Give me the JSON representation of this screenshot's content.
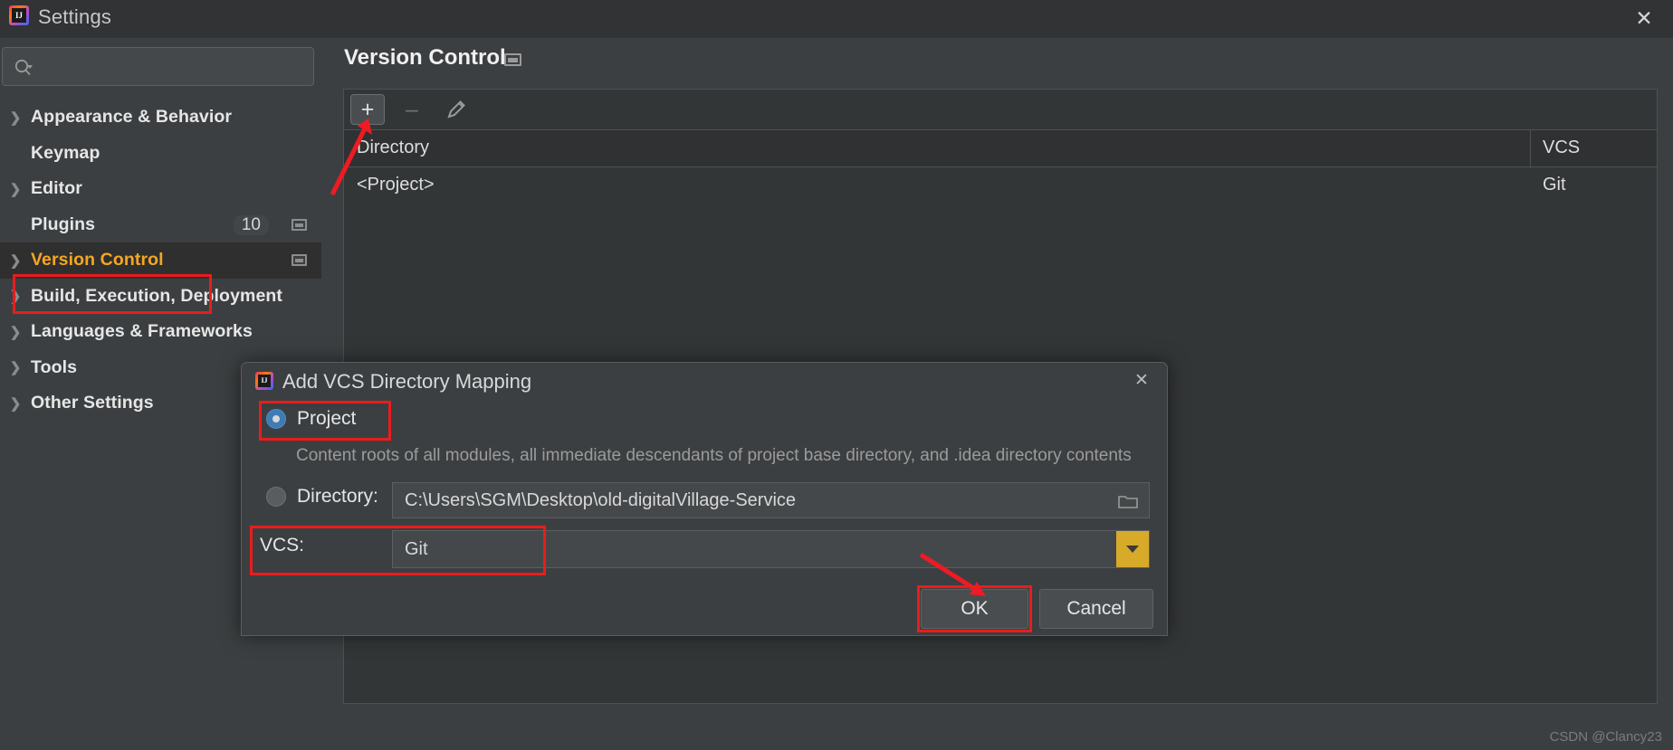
{
  "window": {
    "title": "Settings",
    "app_icon": "intellij-idea-icon",
    "close_label": "✕"
  },
  "sidebar": {
    "search": {
      "placeholder": "",
      "value": "",
      "icon": "search-icon"
    },
    "items": [
      {
        "label": "Appearance & Behavior",
        "expandable": true,
        "selected": false,
        "badge": "",
        "window_icon": false
      },
      {
        "label": "Keymap",
        "expandable": false,
        "selected": false,
        "badge": "",
        "window_icon": false
      },
      {
        "label": "Editor",
        "expandable": true,
        "selected": false,
        "badge": "",
        "window_icon": false
      },
      {
        "label": "Plugins",
        "expandable": false,
        "selected": false,
        "badge": "10",
        "window_icon": true
      },
      {
        "label": "Version Control",
        "expandable": true,
        "selected": true,
        "badge": "",
        "window_icon": true
      },
      {
        "label": "Build, Execution, Deployment",
        "expandable": true,
        "selected": false,
        "badge": "",
        "window_icon": false
      },
      {
        "label": "Languages & Frameworks",
        "expandable": true,
        "selected": false,
        "badge": "",
        "window_icon": false
      },
      {
        "label": "Tools",
        "expandable": true,
        "selected": false,
        "badge": "",
        "window_icon": false
      },
      {
        "label": "Other Settings",
        "expandable": true,
        "selected": false,
        "badge": "",
        "window_icon": false
      }
    ]
  },
  "main": {
    "page_title": "Version Control",
    "toolbar": {
      "add_label": "+",
      "remove_label": "–",
      "edit_icon": "pencil-icon"
    },
    "table": {
      "columns": [
        "Directory",
        "VCS"
      ],
      "rows": [
        {
          "directory": "<Project>",
          "vcs": "Git"
        }
      ]
    }
  },
  "dialog": {
    "title": "Add VCS Directory Mapping",
    "close_label": "✕",
    "project_radio_label": "Project",
    "project_radio_checked": true,
    "project_help": "Content roots of all modules, all immediate descendants of project base directory, and .idea directory contents",
    "directory_radio_label": "Directory:",
    "directory_radio_checked": false,
    "directory_value": "C:\\Users\\SGM\\Desktop\\old-digitalVillage-Service",
    "browse_icon": "folder-icon",
    "vcs_label": "VCS:",
    "vcs_value": "Git",
    "vcs_dropdown_icon": "chevron-down-icon",
    "ok_label": "OK",
    "cancel_label": "Cancel"
  },
  "annotations": {
    "highlight_color": "#ea1c1c",
    "arrow_color": "#ee1b24",
    "boxes": [
      "version-control-sidebar-item",
      "project-radio",
      "vcs-field",
      "ok-button"
    ],
    "arrows": [
      "arrow-to-add-button",
      "arrow-to-ok-button"
    ]
  },
  "watermark": {
    "text": "CSDN @Clancy23"
  }
}
